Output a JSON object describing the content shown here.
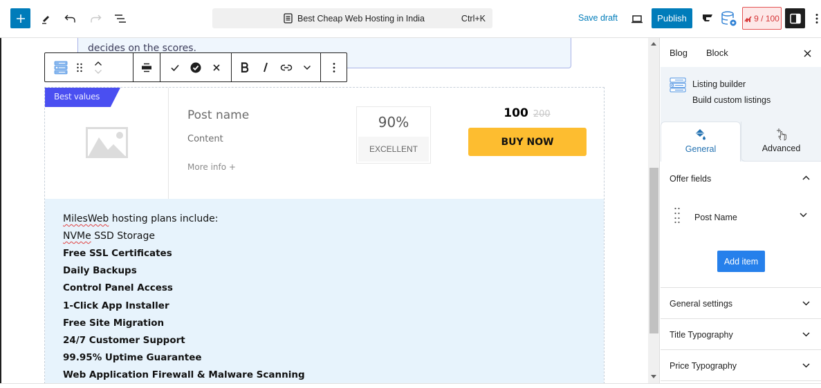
{
  "topbar": {
    "add_block_icon": "plus-icon",
    "tools_icon": "pencil-icon",
    "undo_icon": "undo-icon",
    "redo_icon": "redo-icon",
    "outline_icon": "list-view-icon",
    "command_bar": {
      "title": "Best Cheap Web Hosting in India",
      "shortcut": "Ctrl+K",
      "icon": "document-icon"
    },
    "save_draft_label": "Save draft",
    "preview_icon": "laptop-icon",
    "publish_label": "Publish",
    "plugin_icons": [
      "g-logo-icon",
      "database-icon"
    ],
    "seo_score": "9 / 100",
    "sidebar_toggle_icon": "sidebar-icon",
    "options_icon": "kebab-icon",
    "colors": {
      "accent": "#007cba",
      "score_red": "#d63638"
    }
  },
  "canvas": {
    "prev_block_text": "decides on the scores.",
    "block_toolbar": {
      "groups": [
        [
          "listing-block-icon",
          "drag-handle-icon",
          "move-up-down-icon"
        ],
        [
          "align-icon"
        ],
        [
          "check-icon",
          "check-circle-icon",
          "close-icon"
        ],
        [
          "bold-icon",
          "italic-icon",
          "link-icon",
          "chevron-down-icon"
        ],
        [
          "more-options-icon"
        ]
      ]
    },
    "listing": {
      "ribbon": "Best values",
      "post_name": "Post name",
      "content": "Content",
      "more_info": "More info +",
      "score_percent": "90%",
      "score_label": "EXCELLENT",
      "price_current": "100",
      "price_old": "200",
      "buy_button": "BUY NOW",
      "colors": {
        "ribbon": "#4a4ff1",
        "buy_button": "#fdbd30",
        "body_bg": "#e7f3fc"
      },
      "features": [
        {
          "text": "MilesWeb hosting plans include:",
          "bold": false,
          "misspelled": "MilesWeb"
        },
        {
          "text": "NVMe SSD Storage",
          "bold": false,
          "misspelled": "NVMe"
        },
        {
          "text": "Free SSL Certificates",
          "bold": true
        },
        {
          "text": "Daily Backups",
          "bold": true
        },
        {
          "text": "Control Panel Access",
          "bold": true
        },
        {
          "text": "1-Click App Installer",
          "bold": true
        },
        {
          "text": "Free Site Migration",
          "bold": true
        },
        {
          "text": "24/7 Customer Support",
          "bold": true
        },
        {
          "text": "99.95% Uptime Guarantee",
          "bold": true
        },
        {
          "text": "Web Application Firewall & Malware Scanning",
          "bold": true
        }
      ]
    }
  },
  "sidebar": {
    "tabs": [
      "Blog",
      "Block"
    ],
    "close_icon": "close-icon",
    "block": {
      "name": "Listing builder",
      "description": "Build custom listings",
      "icon": "listing-block-icon"
    },
    "panel_tabs": [
      {
        "label": "General",
        "icon": "paint-bucket-icon",
        "active": true
      },
      {
        "label": "Advanced",
        "icon": "hand-pointer-icon",
        "active": false
      }
    ],
    "offer_fields": {
      "title": "Offer fields",
      "items": [
        {
          "name": "Post Name"
        }
      ],
      "add_item_label": "Add item"
    },
    "panels": [
      {
        "title": "General settings"
      },
      {
        "title": "Title Typography"
      },
      {
        "title": "Price Typography"
      }
    ]
  }
}
